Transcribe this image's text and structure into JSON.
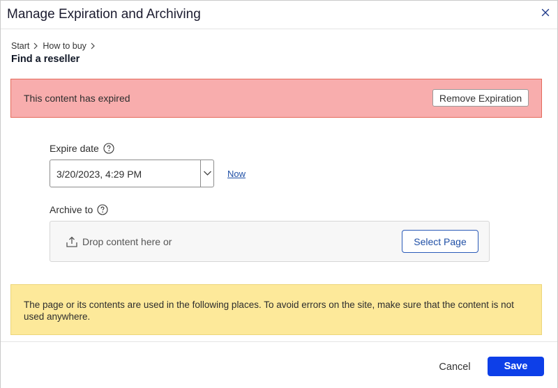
{
  "dialog": {
    "title": "Manage Expiration and Archiving",
    "close_icon": "close-icon"
  },
  "breadcrumb": {
    "items": [
      "Start",
      "How to buy"
    ],
    "separator_icon": "chevron-right-icon",
    "current": "Find a reseller"
  },
  "expired_banner": {
    "message": "This content has expired",
    "button_label": "Remove Expiration",
    "background_color": "#f8adad",
    "border_color": "#e46a5a"
  },
  "expire_date": {
    "label": "Expire date",
    "help_icon": "help-circle-icon",
    "value": "3/20/2023, 4:29 PM",
    "dropdown_icon": "chevron-down-icon",
    "now_link": "Now"
  },
  "archive_to": {
    "label": "Archive to",
    "help_icon": "help-circle-icon",
    "upload_icon": "upload-icon",
    "drop_text": "Drop content here or",
    "select_button": "Select Page"
  },
  "warning_banner": {
    "message": "The page or its contents are used in the following places. To avoid errors on the site, make sure that the content is not used anywhere.",
    "background_color": "#fde99a"
  },
  "footer": {
    "cancel_label": "Cancel",
    "save_label": "Save",
    "primary_color": "#0d3fe8"
  }
}
